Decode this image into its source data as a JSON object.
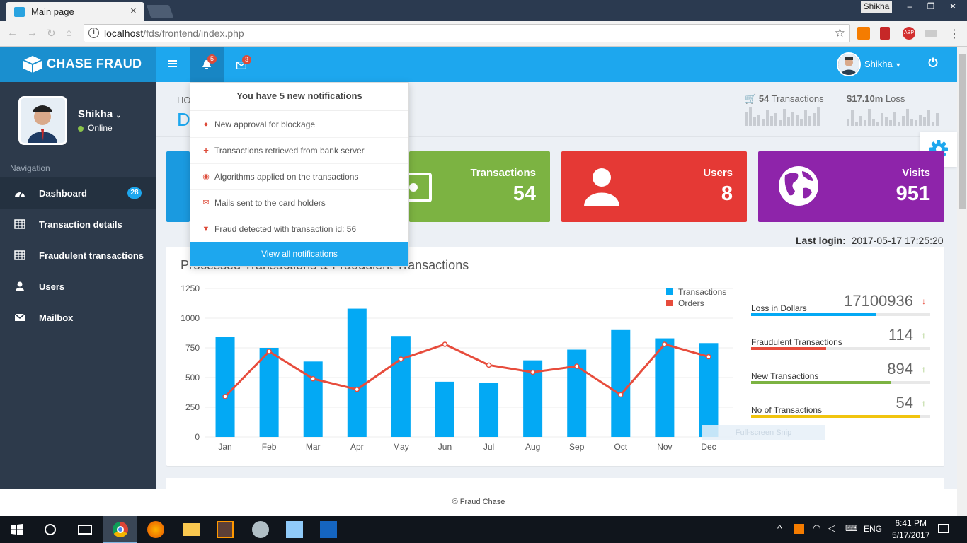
{
  "browser": {
    "tab_title": "Main page",
    "tab_close": "×",
    "profile_name": "Shikha",
    "window_buttons": [
      "–",
      "❐",
      "✕"
    ],
    "url_host": "localhost",
    "url_path": "/fds/frontend/index.php",
    "star": "☆"
  },
  "app": {
    "brand": "CHASE FRAUD",
    "notif_count": "5",
    "mail_count": "3",
    "user_name": "Shikha"
  },
  "sidebar": {
    "profile_name": "Shikha",
    "status": "Online",
    "nav_label": "Navigation",
    "items": [
      {
        "label": "Dashboard",
        "icon": "dashboard-icon",
        "badge": "28"
      },
      {
        "label": "Transaction details",
        "icon": "table-icon"
      },
      {
        "label": "Fraudulent transactions",
        "icon": "table-icon"
      },
      {
        "label": "Users",
        "icon": "user-icon"
      },
      {
        "label": "Mailbox",
        "icon": "envelope-icon"
      }
    ]
  },
  "header": {
    "crumb": "HO",
    "title": "D",
    "stat_transactions_value": "54",
    "stat_transactions_label": "Transactions",
    "stat_loss_value": "$17.10m",
    "stat_loss_label": "Loss"
  },
  "cards": [
    {
      "title": "Transactions",
      "value": "54",
      "color": "#7cb342"
    },
    {
      "title": "Users",
      "value": "8",
      "color": "#e53935"
    },
    {
      "title": "Visits",
      "value": "951",
      "color": "#8e24aa"
    }
  ],
  "last_login": {
    "label": "Last login",
    "value": "2017-05-17 17:25:20"
  },
  "chart": {
    "title": "Processed Transactions & Fraudulent Transactions"
  },
  "chart_data": {
    "type": "bar",
    "categories": [
      "Jan",
      "Feb",
      "Mar",
      "Apr",
      "May",
      "Jun",
      "Jul",
      "Aug",
      "Sep",
      "Oct",
      "Nov",
      "Dec"
    ],
    "series": [
      {
        "name": "Transactions",
        "type": "bar",
        "color": "#03a9f4",
        "values": [
          840,
          750,
          635,
          1080,
          850,
          465,
          455,
          645,
          735,
          900,
          830,
          790
        ]
      },
      {
        "name": "Orders",
        "type": "line",
        "color": "#e74c3c",
        "values": [
          340,
          720,
          490,
          400,
          655,
          780,
          605,
          545,
          595,
          355,
          780,
          675
        ]
      }
    ],
    "ylim": [
      0,
      1250
    ],
    "yticks": [
      0,
      250,
      500,
      750,
      1000,
      1250
    ],
    "grid": true,
    "legend": "top-right"
  },
  "progress": [
    {
      "label": "Loss in Dollars",
      "value": "17100936",
      "trend": "down",
      "fill": 0.7,
      "color": "#03a9f4"
    },
    {
      "label": "Fraudulent Transactions",
      "value": "114",
      "trend": "up",
      "fill": 0.42,
      "color": "#e74c3c"
    },
    {
      "label": "New Transactions",
      "value": "894",
      "trend": "up",
      "fill": 0.78,
      "color": "#7cb342"
    },
    {
      "label": "No of Transactions",
      "value": "54",
      "trend": "up",
      "fill": 0.94,
      "color": "#f1c40f"
    }
  ],
  "notifications": {
    "header": "You have 5 new notifications",
    "items": [
      {
        "text": "New approval for blockage",
        "icon": "comment-icon"
      },
      {
        "text": "Transactions retrieved from bank server",
        "icon": "plus-icon"
      },
      {
        "text": "Algorithms applied on the transactions",
        "icon": "eye-icon"
      },
      {
        "text": "Mails sent to the card holders",
        "icon": "envelope-icon"
      },
      {
        "text": "Fraud detected with transaction id: 56",
        "icon": "cart-icon"
      }
    ],
    "footer": "View all notifications"
  },
  "snip_text": "Full-screen Snip",
  "footer": "© Fraud Chase",
  "taskbar": {
    "time": "6:41 PM",
    "date": "5/17/2017",
    "lang": "ENG"
  }
}
